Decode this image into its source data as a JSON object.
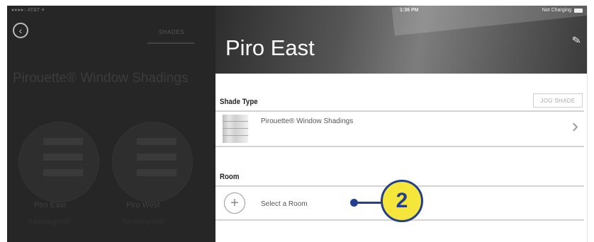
{
  "status_bar": {
    "carrier": "●●●●○ AT&T ✈",
    "time": "1:36 PM",
    "battery_text": "Not Charging"
  },
  "left_panel": {
    "tab_label": "SHADES",
    "title": "Pirouette® Window Shadings",
    "shades": [
      {
        "name": "Piro East",
        "sub": "(Unassigned)"
      },
      {
        "name": "Piro West",
        "sub": "(Unassigned)"
      }
    ]
  },
  "detail": {
    "title": "Piro East",
    "shade_type_label": "Shade Type",
    "jog_button": "JOG SHADE",
    "shade_type_value": "Pirouette® Window Shadings",
    "room_label": "Room",
    "room_placeholder": "Select a Room"
  },
  "callout": {
    "number": "2"
  },
  "icons": {
    "back": "back-circle-icon",
    "edit": "pencil-icon",
    "chevron": "chevron-right-icon",
    "add": "plus-circle-icon"
  },
  "colors": {
    "callout_fill": "#f6e63c",
    "callout_stroke": "#233f8e",
    "left_overlay": "#262626"
  }
}
